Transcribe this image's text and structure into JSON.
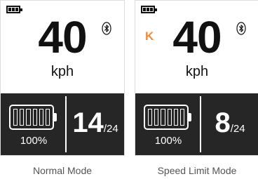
{
  "normal": {
    "speed": "40",
    "unit": "kph",
    "battery_percent": "100%",
    "assist_level": "14",
    "assist_max": "/24",
    "caption": "Normal Mode"
  },
  "limit": {
    "indicator": "K",
    "speed": "40",
    "unit": "kph",
    "battery_percent": "100%",
    "assist_level": "8",
    "assist_max": "/24",
    "caption": "Speed Limit Mode"
  },
  "icons": {
    "battery": "battery-icon",
    "bluetooth": "bluetooth-icon"
  },
  "colors": {
    "bottom_bar": "#262626",
    "limit_indicator": "#f08a3c",
    "text": "#111111"
  }
}
